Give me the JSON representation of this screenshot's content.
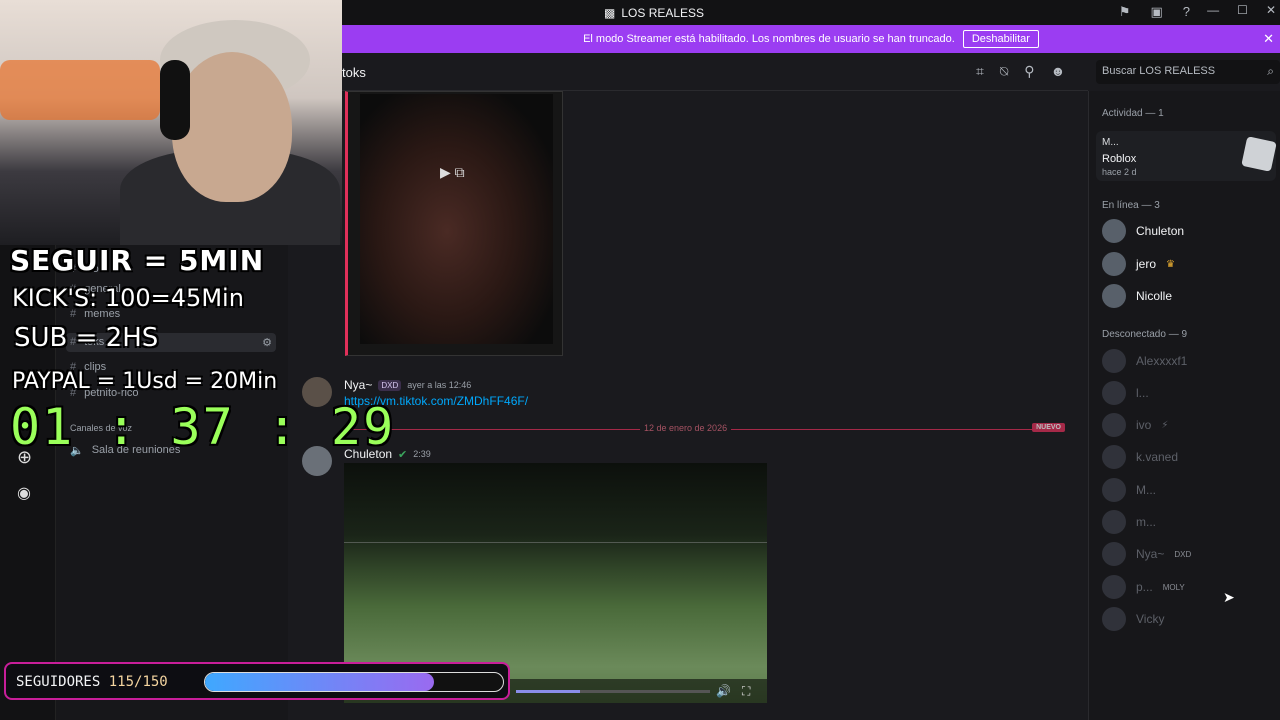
{
  "titlebar": {
    "title": "LOS REALESS"
  },
  "banner": {
    "text": "El modo Streamer está habilitado. Los nombres de usuario se han truncado.",
    "button": "Deshabilitar"
  },
  "channel_header": {
    "name": "toks"
  },
  "search": {
    "placeholder": "Buscar LOS REALESS"
  },
  "channels": {
    "items": [
      "xto",
      "general",
      "memes",
      "toks",
      "clips",
      "petnito-rico"
    ],
    "voice_header": "Canales de voz",
    "voice_item": "Sala de reuniones"
  },
  "messages": [
    {
      "author": "Nya~",
      "tag": "DXD",
      "time": "ayer a las 12:46",
      "link": "https://vm.tiktok.com/ZMDhFF46F/"
    },
    {
      "author": "Chuleton",
      "time": "2:39"
    }
  ],
  "divider": {
    "date": "12 de enero de 2026",
    "badge": "NUEVO"
  },
  "video": {
    "progress": 0.33
  },
  "members": {
    "activity_header": "Actividad — 1",
    "activity": {
      "user": "M...",
      "game": "Roblox",
      "time": "hace 2 d"
    },
    "online_header": "En línea — 3",
    "online": [
      {
        "name": "Chuleton"
      },
      {
        "name": "jero"
      },
      {
        "name": "Nicolle"
      }
    ],
    "offline_header": "Desconectado — 9",
    "offline": [
      {
        "name": "Alexxxxf1",
        "badge": ""
      },
      {
        "name": "l...",
        "badge": ""
      },
      {
        "name": "ivo",
        "badge": ""
      },
      {
        "name": "k.vaned",
        "badge": ""
      },
      {
        "name": "M...",
        "badge": ""
      },
      {
        "name": "m...",
        "badge": ""
      },
      {
        "name": "Nya~",
        "badge": "DXD"
      },
      {
        "name": "p...",
        "badge": "MOLY"
      },
      {
        "name": "Vicky",
        "badge": ""
      }
    ]
  },
  "overlay": {
    "seguir": "SEGUIR = 5MIN",
    "kicks": "KICK'S: 100=45Min",
    "sub": "SUB = 2HS",
    "paypal": "PAYPAL = 1Usd = 20Min",
    "timer": "01 : 37 : 29",
    "followers_label": "SEGUIDORES",
    "followers_count": "115/150",
    "followers_progress": 0.767
  },
  "colors": {
    "accent": "#9b3df2",
    "new_divider": "#e0305a",
    "timer": "#9aff5a"
  }
}
